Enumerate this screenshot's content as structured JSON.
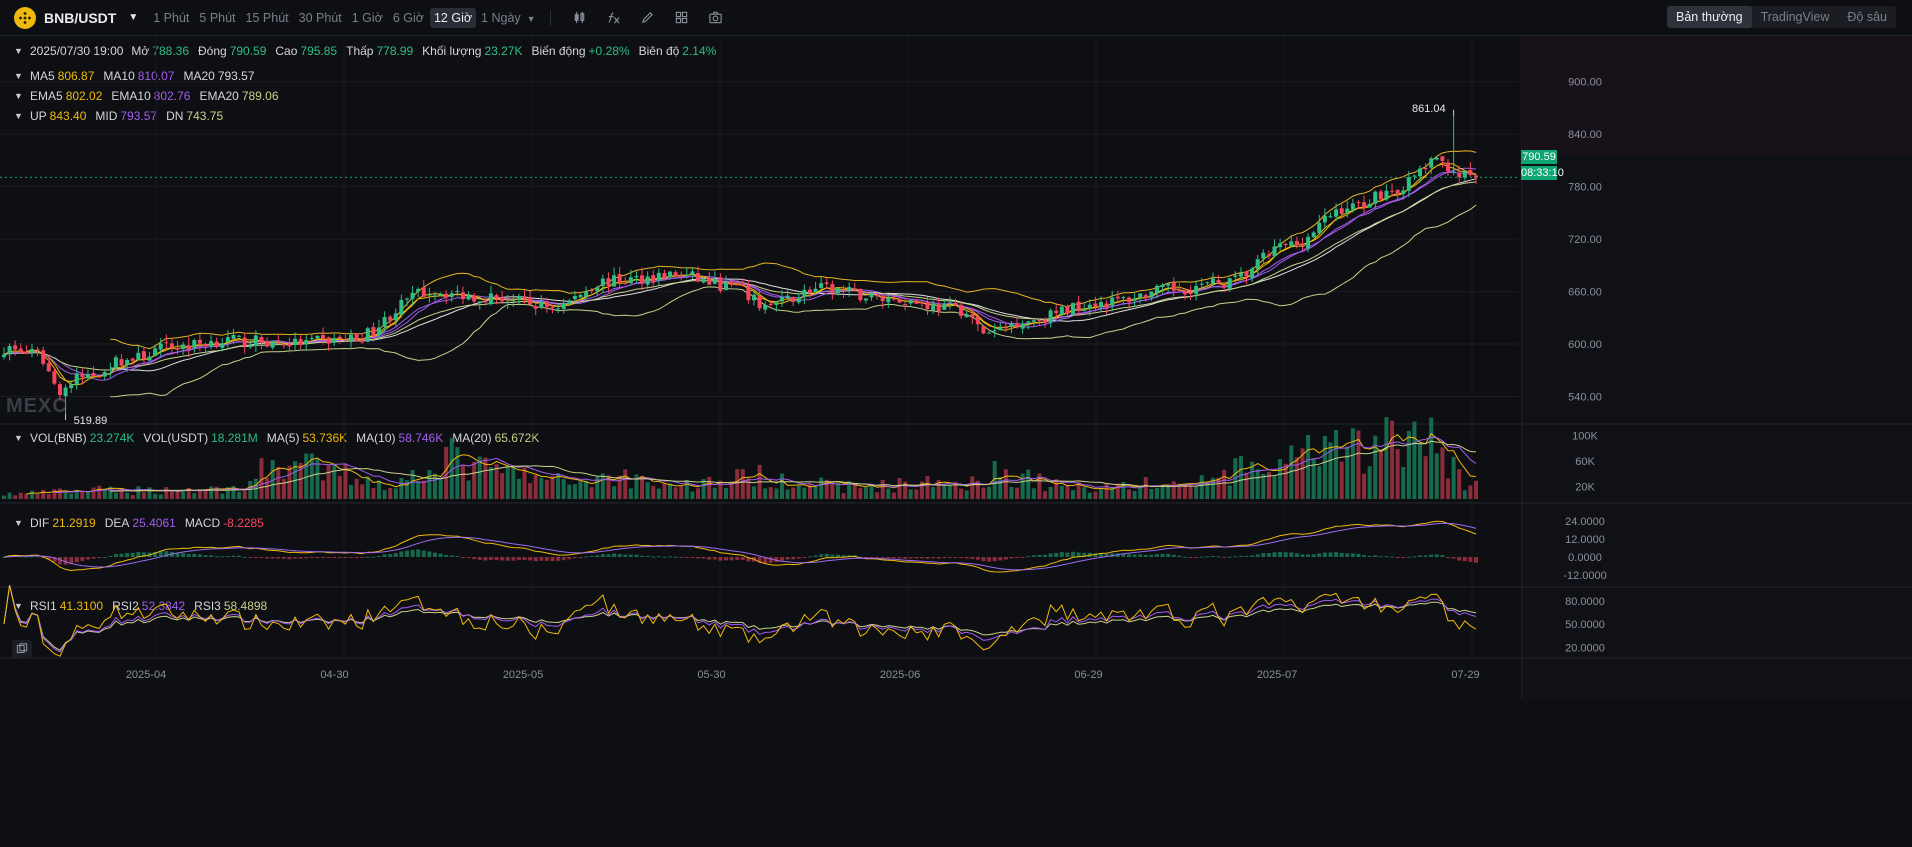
{
  "header": {
    "pair": "BNB/USDT",
    "timeframes": [
      "1 Phút",
      "5 Phút",
      "15 Phút",
      "30 Phút",
      "1 Giờ",
      "6 Giờ",
      "12 Giờ"
    ],
    "active_timeframe": "12 Giờ",
    "more_timeframe": "1 Ngày",
    "views": [
      "Bản thường",
      "TradingView",
      "Độ sâu"
    ],
    "active_view": "Bản thường",
    "tools": [
      "candle-style-icon",
      "indicator-icon",
      "draw-icon",
      "layout-icon",
      "camera-icon"
    ]
  },
  "info": {
    "date": "2025/07/30 19:00",
    "open_label": "Mở",
    "open": "788.36",
    "close_label": "Đóng",
    "close": "790.59",
    "high_label": "Cao",
    "high": "795.85",
    "low_label": "Thấp",
    "low": "778.99",
    "vol_label": "Khối lượng",
    "vol": "23.27K",
    "change_label": "Biến động",
    "change": "+0.28%",
    "amp_label": "Biên độ",
    "amp": "2.14%"
  },
  "indicators": {
    "ma": [
      {
        "label": "MA5",
        "value": "806.87"
      },
      {
        "label": "MA10",
        "value": "810.07"
      },
      {
        "label": "MA20",
        "value": "793.57"
      }
    ],
    "ema": [
      {
        "label": "EMA5",
        "value": "802.02"
      },
      {
        "label": "EMA10",
        "value": "802.76"
      },
      {
        "label": "EMA20",
        "value": "789.06"
      }
    ],
    "boll": [
      {
        "label": "UP",
        "value": "843.40"
      },
      {
        "label": "MID",
        "value": "793.57"
      },
      {
        "label": "DN",
        "value": "743.75"
      }
    ],
    "vol": [
      {
        "label": "VOL(BNB)",
        "value": "23.274K"
      },
      {
        "label": "VOL(USDT)",
        "value": "18.281M"
      },
      {
        "label": "MA(5)",
        "value": "53.736K"
      },
      {
        "label": "MA(10)",
        "value": "58.746K"
      },
      {
        "label": "MA(20)",
        "value": "65.672K"
      }
    ],
    "macd": [
      {
        "label": "DIF",
        "value": "21.2919"
      },
      {
        "label": "DEA",
        "value": "25.4061"
      },
      {
        "label": "MACD",
        "value": "-8.2285"
      }
    ],
    "rsi": [
      {
        "label": "RSI1",
        "value": "41.3100"
      },
      {
        "label": "RSI2",
        "value": "52.3842"
      },
      {
        "label": "RSI3",
        "value": "58.4898"
      }
    ]
  },
  "price_tag": {
    "price": "790.59",
    "countdown": "08:33:10"
  },
  "watermark": "MEXC",
  "colors": {
    "up": "#2ebd85",
    "down": "#f6465d",
    "ma5": "#f0b90b",
    "ma10": "#a45cf0",
    "ma20": "#e0e0e0",
    "ema5": "#f0b90b",
    "ema10": "#a45cf0",
    "ema20": "#c8d18a",
    "boll": "#e6b422",
    "dif": "#f0b90b",
    "dea": "#9a6cf0",
    "rsi1": "#f0b90b",
    "rsi2": "#a45cf0",
    "rsi3": "#c8d18a"
  },
  "chart_data": {
    "type": "candlestick",
    "title": "BNB/USDT",
    "interval": "12 Giờ",
    "price_axis": {
      "ticks": [
        "900.00",
        "840.00",
        "780.00",
        "720.00",
        "660.00",
        "600.00",
        "540.00"
      ],
      "range": [
        512,
        918
      ]
    },
    "volume_axis": {
      "ticks": [
        "100K",
        "60K",
        "20K"
      ],
      "range": [
        0,
        110000
      ]
    },
    "macd_axis": {
      "ticks": [
        "24.0000",
        "12.0000",
        "0.0000",
        "-12.0000"
      ],
      "range": [
        -16,
        28
      ]
    },
    "rsi_axis": {
      "ticks": [
        "80.0000",
        "50.0000",
        "20.0000"
      ],
      "range": [
        10,
        90
      ]
    },
    "x_labels": [
      "2025-04",
      "04-30",
      "2025-05",
      "05-30",
      "2025-06",
      "06-29",
      "2025-07",
      "07-29"
    ],
    "annotations": {
      "high": "861.04",
      "low": "519.89"
    },
    "anchors": [
      [
        0,
        595
      ],
      [
        6,
        588
      ],
      [
        10,
        548
      ],
      [
        14,
        562
      ],
      [
        22,
        582
      ],
      [
        30,
        597
      ],
      [
        40,
        604
      ],
      [
        52,
        601
      ],
      [
        62,
        606
      ],
      [
        76,
        660
      ],
      [
        86,
        654
      ],
      [
        98,
        643
      ],
      [
        108,
        672
      ],
      [
        120,
        679
      ],
      [
        130,
        666
      ],
      [
        136,
        644
      ],
      [
        146,
        663
      ],
      [
        158,
        652
      ],
      [
        170,
        641
      ],
      [
        176,
        612
      ],
      [
        182,
        627
      ],
      [
        196,
        648
      ],
      [
        210,
        663
      ],
      [
        218,
        670
      ],
      [
        230,
        714
      ],
      [
        240,
        756
      ],
      [
        248,
        775
      ],
      [
        256,
        808
      ],
      [
        262,
        790
      ]
    ],
    "volume_anchors": [
      [
        0,
        8000
      ],
      [
        18,
        14000
      ],
      [
        40,
        16000
      ],
      [
        50,
        58000
      ],
      [
        60,
        40000
      ],
      [
        70,
        24000
      ],
      [
        78,
        68000
      ],
      [
        88,
        44000
      ],
      [
        100,
        28000
      ],
      [
        110,
        36000
      ],
      [
        120,
        22000
      ],
      [
        136,
        36000
      ],
      [
        150,
        20000
      ],
      [
        170,
        26000
      ],
      [
        178,
        42000
      ],
      [
        190,
        20000
      ],
      [
        210,
        24000
      ],
      [
        224,
        48000
      ],
      [
        236,
        72000
      ],
      [
        248,
        92000
      ],
      [
        256,
        88000
      ],
      [
        262,
        23000
      ]
    ]
  }
}
